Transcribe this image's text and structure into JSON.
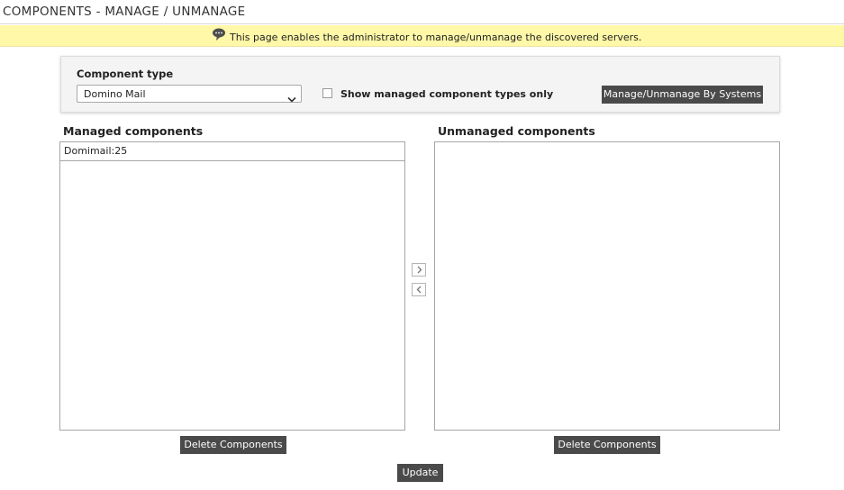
{
  "header": {
    "title": "COMPONENTS - MANAGE / UNMANAGE"
  },
  "banner": {
    "icon": "speech-bubble-icon",
    "message": "This page enables the administrator to manage/unmanage the discovered servers."
  },
  "filter": {
    "component_type_label": "Component type",
    "component_type_value": "Domino Mail",
    "show_managed_only_label": "Show managed component types only",
    "show_managed_only_checked": false,
    "manage_by_systems_label": "Manage/Unmanage By Systems"
  },
  "managed": {
    "label": "Managed components",
    "items": [
      "Domimail:25"
    ],
    "delete_label": "Delete Components"
  },
  "unmanaged": {
    "label": "Unmanaged components",
    "items": [],
    "delete_label": "Delete Components"
  },
  "transfer": {
    "to_unmanaged_icon": "chevron-right-icon",
    "to_managed_icon": "chevron-left-icon"
  },
  "actions": {
    "update_label": "Update"
  },
  "colors": {
    "banner_bg": "#fff8a8",
    "button_bg": "#4a4a4a"
  }
}
